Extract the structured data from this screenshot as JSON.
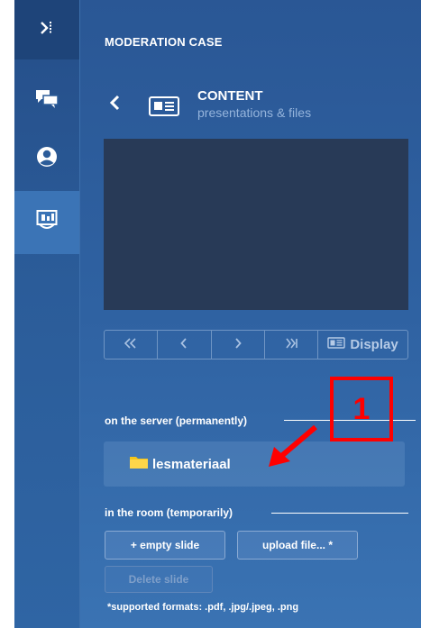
{
  "header": {
    "title": "MODERATION CASE"
  },
  "rail": {
    "items": [
      {
        "icon": "collapse-panel-icon"
      },
      {
        "icon": "chat-bubbles-icon"
      },
      {
        "icon": "user-circle-icon"
      },
      {
        "icon": "presentation-board-icon"
      }
    ]
  },
  "content": {
    "heading": "CONTENT",
    "subheading": "presentations & files"
  },
  "slide_nav": {
    "first": "K",
    "prev": "<",
    "next": ">",
    "last": ">|",
    "display_label": "Display"
  },
  "server": {
    "label": "on the server (permanently)",
    "folder_name": "lesmateriaal"
  },
  "room": {
    "label": "in the room (temporarily)",
    "empty_slide_label": "+ empty slide",
    "upload_label": "upload file... *",
    "delete_label": "Delete slide",
    "formats_note": "*supported formats: .pdf, .jpg/.jpeg, .png"
  },
  "annotation": {
    "number": "1"
  },
  "colors": {
    "rail_bg": "#2b5c99",
    "panel_bg": "#2f62a2",
    "preview_bg": "#283a57",
    "annotation_red": "#ff0000",
    "folder_yellow": "#f5c518"
  }
}
